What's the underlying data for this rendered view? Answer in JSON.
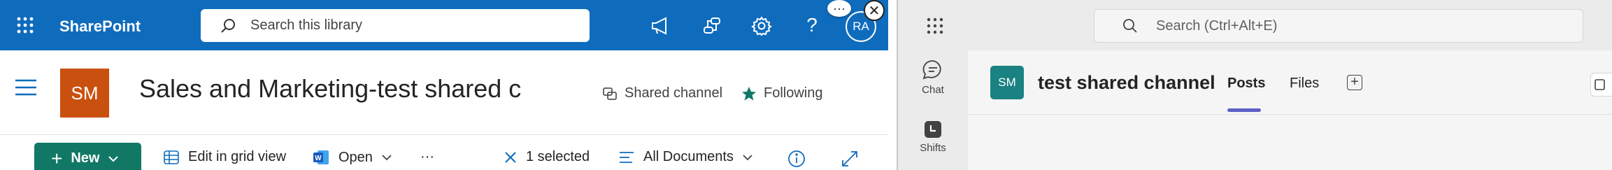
{
  "sharepoint": {
    "brand": "SharePoint",
    "search": {
      "placeholder": "Search this library"
    },
    "avatar_initials": "RA",
    "overlay_more": "···",
    "overlay_close": "✕",
    "site": {
      "logo_initials": "SM",
      "title": "Sales and Marketing-test shared c",
      "shared_channel_label": "Shared channel",
      "following_label": "Following"
    },
    "commands": {
      "new_label": "New",
      "edit_grid_label": "Edit in grid view",
      "open_label": "Open",
      "more_label": "···",
      "selected_label": "1 selected",
      "view_label": "All Documents"
    },
    "colors": {
      "suite_bar": "#0f6cbd",
      "site_logo": "#ca5010",
      "new_button": "#117865"
    }
  },
  "teams": {
    "search": {
      "placeholder": "Search (Ctrl+Alt+E)"
    },
    "rail": [
      {
        "label": "Chat",
        "icon": "chat-icon"
      },
      {
        "label": "Shifts",
        "icon": "shifts-icon"
      }
    ],
    "channel": {
      "avatar_initials": "SM",
      "name": "test shared channel",
      "tabs": [
        {
          "label": "Posts",
          "selected": true
        },
        {
          "label": "Files",
          "selected": false
        }
      ],
      "add_tab_label": "+"
    },
    "colors": {
      "channel_avatar": "#1a8282",
      "tab_indicator": "#5b5fc7"
    }
  }
}
